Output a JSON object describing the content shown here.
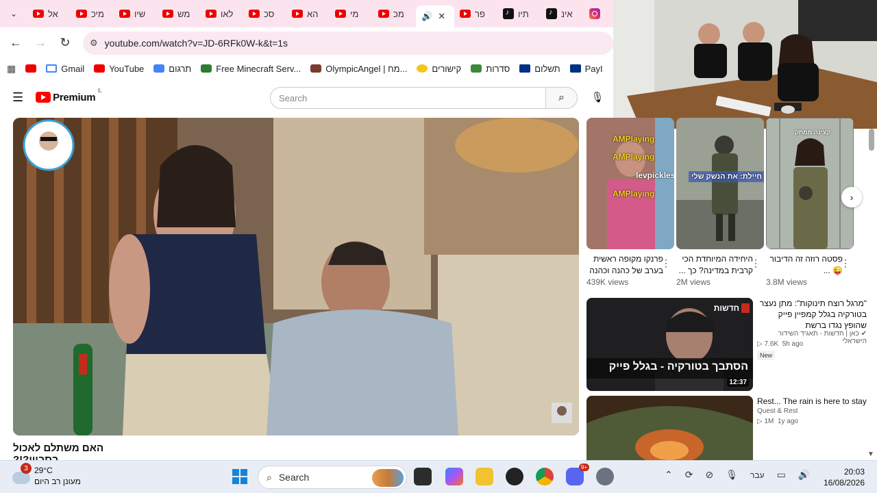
{
  "tabstrip": {
    "tabs": [
      {
        "label": "אל",
        "icon": "youtube-icon"
      },
      {
        "label": "מיכ",
        "icon": "youtube-icon"
      },
      {
        "label": "שיו",
        "icon": "youtube-icon"
      },
      {
        "label": "מש",
        "icon": "youtube-icon"
      },
      {
        "label": "לאו",
        "icon": "youtube-icon"
      },
      {
        "label": "סכ",
        "icon": "youtube-icon"
      },
      {
        "label": "הא",
        "icon": "youtube-icon"
      },
      {
        "label": "מי",
        "icon": "youtube-icon"
      },
      {
        "label": "מכ",
        "icon": "youtube-icon"
      },
      {
        "label": "פר",
        "icon": "youtube-icon"
      },
      {
        "label": "תיו",
        "icon": "tiktok-icon"
      },
      {
        "label": "אינ",
        "icon": "tiktok-icon"
      }
    ]
  },
  "address": {
    "url": "youtube.com/watch?v=JD-6RFk0W-k&t=1s"
  },
  "bookmarks": [
    {
      "label": "Gmail",
      "icon": "gmail-icon"
    },
    {
      "label": "YouTube",
      "icon": "youtube-icon"
    },
    {
      "label": "תרגום",
      "icon": "google-translate-icon"
    },
    {
      "label": "Free Minecraft Serv...",
      "icon": "minecraft-icon"
    },
    {
      "label": "OlympicAngel | מח...",
      "icon": "profile-image-icon"
    },
    {
      "label": "קישורים",
      "icon": "star-icon"
    },
    {
      "label": "סדרות",
      "icon": "folder-icon"
    },
    {
      "label": "תשלום",
      "icon": "paypal-icon"
    },
    {
      "label": "PayI",
      "icon": "paypal-icon"
    }
  ],
  "youtube": {
    "logo": "Premium",
    "country": "IL",
    "search_placeholder": "Search"
  },
  "video": {
    "title": "האם משתלם לאכול בסביון?!?"
  },
  "shorts": [
    {
      "title": "פרנקו מקופה ראשית בערב של כהנה וכהנה",
      "views": "439K views",
      "overlay": [
        "AMPlaying",
        "AMPlaying",
        "levpickles",
        "AMPlaying"
      ]
    },
    {
      "title": "היחידה המיוחדת הכי קרבית במדינה? כך ...",
      "views": "2M views",
      "overlay": [
        "חיילת: את הנשק שלי"
      ]
    },
    {
      "title": "פסטה רוזה זה הדיבור 😜 ...",
      "views": "3.8M views",
      "overlay": [
        "קצינה ממתק"
      ]
    }
  ],
  "recommendations": [
    {
      "title": "\"מרגל רוצח תינוקות\": מתן נעצר בטורקיה בגלל קמפיין פייק שהופץ נגדו ברשת",
      "channel": "כאן | חדשות - תאגיד השידור הישראלי",
      "views": "7.6K",
      "age": "5h ago",
      "badge": "New",
      "duration": "12:37",
      "thumb_text": "הסתבך בטורקיה - בגלל פייק",
      "thumb_tag": "חדשות"
    },
    {
      "title": "Rest... The rain is here to stay",
      "channel": "Quest & Rest",
      "views": "1M",
      "age": "1y ago"
    }
  ],
  "taskbar": {
    "weather": {
      "temp": "29°C",
      "condition": "מעונן רב היום",
      "badge": "3"
    },
    "search": "Search",
    "language": "עבר",
    "time": "20:03",
    "date": "16/08/2026",
    "discord_badge": "9+"
  },
  "colors": {
    "tabstrip": "#fce4ef",
    "omnibox": "#fbe9f1",
    "youtube_red": "#ff0000",
    "taskbar": "#e8edf5"
  }
}
